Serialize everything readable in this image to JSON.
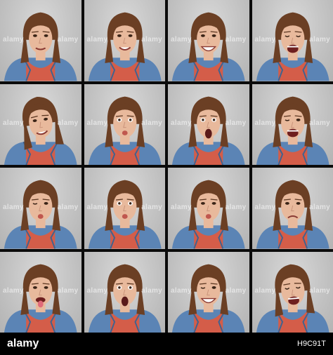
{
  "watermark": "alamy",
  "footer": {
    "logo": "alamy",
    "image_code": "H9C91T"
  },
  "colors": {
    "background_gray": "#c6c6c6",
    "denim": "#5b84b5",
    "shirt": "#d45d49",
    "skin": "#e8b99c",
    "hair": "#6b3f24"
  },
  "tiles": [
    {
      "expression": "soft-smile"
    },
    {
      "expression": "smile"
    },
    {
      "expression": "big-smile"
    },
    {
      "expression": "open-mouth-laugh"
    },
    {
      "expression": "tilted-smile"
    },
    {
      "expression": "pout"
    },
    {
      "expression": "surprised-open-mouth"
    },
    {
      "expression": "wink-laugh"
    },
    {
      "expression": "wink-pout"
    },
    {
      "expression": "kiss"
    },
    {
      "expression": "pursed-lips"
    },
    {
      "expression": "frown"
    },
    {
      "expression": "tongue-out"
    },
    {
      "expression": "surprised-o"
    },
    {
      "expression": "smile-wink"
    },
    {
      "expression": "laugh-head-back"
    }
  ]
}
